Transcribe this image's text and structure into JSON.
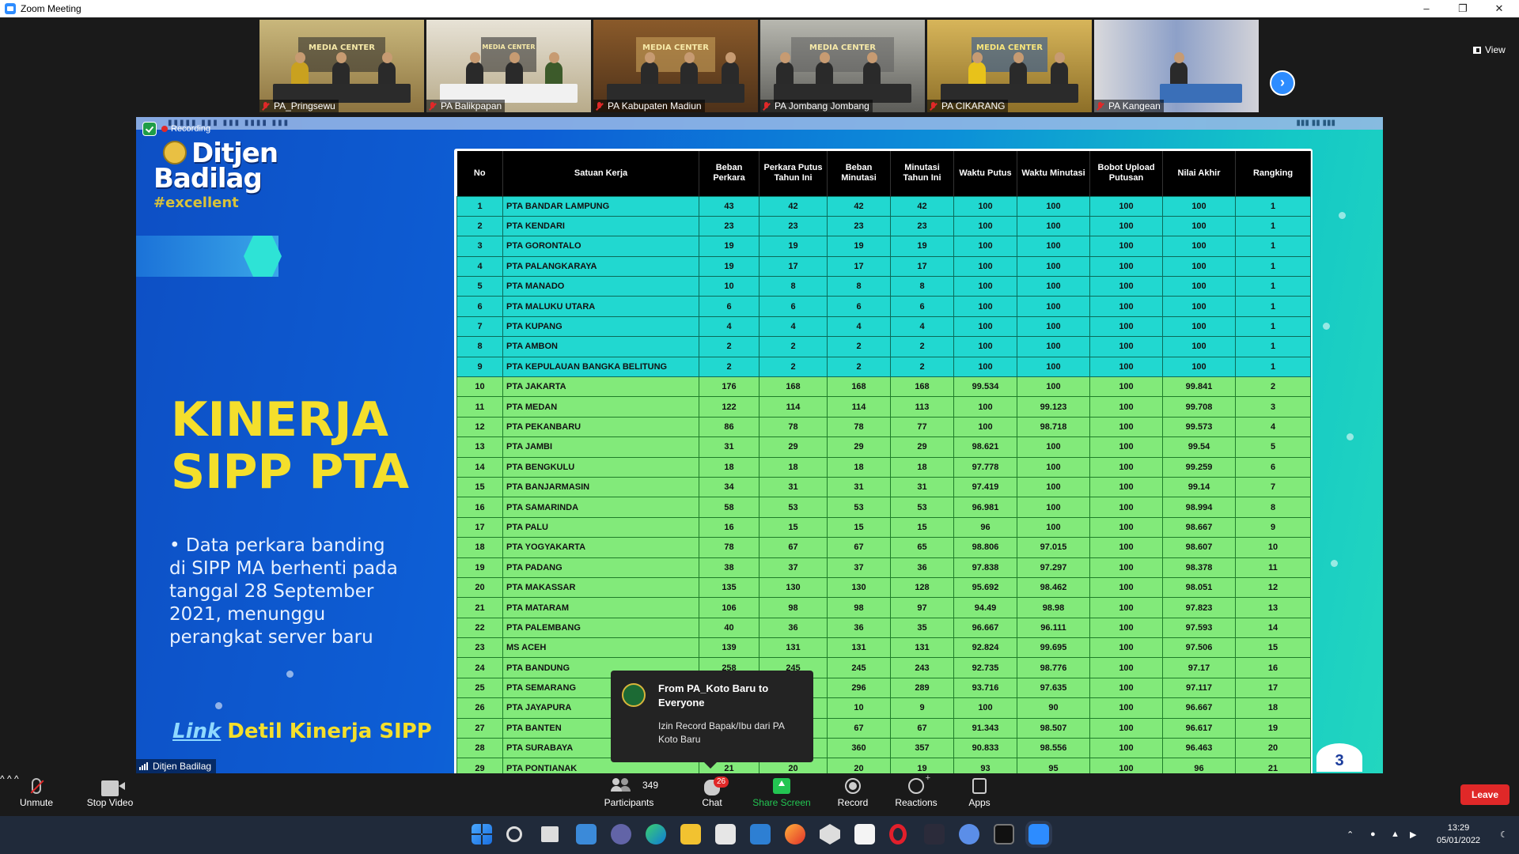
{
  "window": {
    "title": "Zoom Meeting"
  },
  "gallery": {
    "tiles": [
      {
        "name": "PA_Pringsewu",
        "banner": "MEDIA CENTER"
      },
      {
        "name": "PA Balikpapan",
        "banner": "MEDIA CENTER"
      },
      {
        "name": "PA Kabupaten Madiun",
        "banner": "MEDIA CENTER"
      },
      {
        "name": "PA Jombang Jombang",
        "banner": "MEDIA CENTER"
      },
      {
        "name": "PA CIKARANG",
        "banner": "MEDIA CENTER"
      },
      {
        "name": "PA Kangean",
        "banner": ""
      }
    ],
    "view_label": "View"
  },
  "share": {
    "recording_label": "Recording",
    "logo": {
      "line1": "Ditjen",
      "line2": "Badilag",
      "tagline": "#excellent"
    },
    "title_line1": "KINERJA",
    "title_line2": "SIPP PTA",
    "note_bullet": "•",
    "note": "Data perkara banding di SIPP MA berhenti pada tanggal 28 September 2021, menunggu perangkat server baru",
    "link_word": "Link",
    "link_text": "Detil Kinerja SIPP",
    "sharer_name": "Ditjen Badilag",
    "page_number": "3"
  },
  "table": {
    "headers": [
      "No",
      "Satuan Kerja",
      "Beban Perkara",
      "Perkara Putus Tahun Ini",
      "Beban Minutasi",
      "Minutasi Tahun Ini",
      "Waktu Putus",
      "Waktu Minutasi",
      "Bobot Upload Putusan",
      "Nilai Akhir",
      "Rangking"
    ],
    "rows": [
      {
        "c": [
          "1",
          "PTA BANDAR LAMPUNG",
          "43",
          "42",
          "42",
          "42",
          "100",
          "100",
          "100",
          "100",
          "1"
        ],
        "color": "cyan"
      },
      {
        "c": [
          "2",
          "PTA KENDARI",
          "23",
          "23",
          "23",
          "23",
          "100",
          "100",
          "100",
          "100",
          "1"
        ],
        "color": "cyan"
      },
      {
        "c": [
          "3",
          "PTA GORONTALO",
          "19",
          "19",
          "19",
          "19",
          "100",
          "100",
          "100",
          "100",
          "1"
        ],
        "color": "cyan"
      },
      {
        "c": [
          "4",
          "PTA PALANGKARAYA",
          "19",
          "17",
          "17",
          "17",
          "100",
          "100",
          "100",
          "100",
          "1"
        ],
        "color": "cyan"
      },
      {
        "c": [
          "5",
          "PTA MANADO",
          "10",
          "8",
          "8",
          "8",
          "100",
          "100",
          "100",
          "100",
          "1"
        ],
        "color": "cyan"
      },
      {
        "c": [
          "6",
          "PTA MALUKU UTARA",
          "6",
          "6",
          "6",
          "6",
          "100",
          "100",
          "100",
          "100",
          "1"
        ],
        "color": "cyan"
      },
      {
        "c": [
          "7",
          "PTA KUPANG",
          "4",
          "4",
          "4",
          "4",
          "100",
          "100",
          "100",
          "100",
          "1"
        ],
        "color": "cyan"
      },
      {
        "c": [
          "8",
          "PTA AMBON",
          "2",
          "2",
          "2",
          "2",
          "100",
          "100",
          "100",
          "100",
          "1"
        ],
        "color": "cyan"
      },
      {
        "c": [
          "9",
          "PTA KEPULAUAN BANGKA BELITUNG",
          "2",
          "2",
          "2",
          "2",
          "100",
          "100",
          "100",
          "100",
          "1"
        ],
        "color": "cyan"
      },
      {
        "c": [
          "10",
          "PTA JAKARTA",
          "176",
          "168",
          "168",
          "168",
          "99.534",
          "100",
          "100",
          "99.841",
          "2"
        ],
        "color": "green"
      },
      {
        "c": [
          "11",
          "PTA MEDAN",
          "122",
          "114",
          "114",
          "113",
          "100",
          "99.123",
          "100",
          "99.708",
          "3"
        ],
        "color": "green"
      },
      {
        "c": [
          "12",
          "PTA PEKANBARU",
          "86",
          "78",
          "78",
          "77",
          "100",
          "98.718",
          "100",
          "99.573",
          "4"
        ],
        "color": "green"
      },
      {
        "c": [
          "13",
          "PTA JAMBI",
          "31",
          "29",
          "29",
          "29",
          "98.621",
          "100",
          "100",
          "99.54",
          "5"
        ],
        "color": "green"
      },
      {
        "c": [
          "14",
          "PTA BENGKULU",
          "18",
          "18",
          "18",
          "18",
          "97.778",
          "100",
          "100",
          "99.259",
          "6"
        ],
        "color": "green"
      },
      {
        "c": [
          "15",
          "PTA BANJARMASIN",
          "34",
          "31",
          "31",
          "31",
          "97.419",
          "100",
          "100",
          "99.14",
          "7"
        ],
        "color": "green"
      },
      {
        "c": [
          "16",
          "PTA SAMARINDA",
          "58",
          "53",
          "53",
          "53",
          "96.981",
          "100",
          "100",
          "98.994",
          "8"
        ],
        "color": "green"
      },
      {
        "c": [
          "17",
          "PTA PALU",
          "16",
          "15",
          "15",
          "15",
          "96",
          "100",
          "100",
          "98.667",
          "9"
        ],
        "color": "green"
      },
      {
        "c": [
          "18",
          "PTA YOGYAKARTA",
          "78",
          "67",
          "67",
          "65",
          "98.806",
          "97.015",
          "100",
          "98.607",
          "10"
        ],
        "color": "green"
      },
      {
        "c": [
          "19",
          "PTA PADANG",
          "38",
          "37",
          "37",
          "36",
          "97.838",
          "97.297",
          "100",
          "98.378",
          "11"
        ],
        "color": "green"
      },
      {
        "c": [
          "20",
          "PTA MAKASSAR",
          "135",
          "130",
          "130",
          "128",
          "95.692",
          "98.462",
          "100",
          "98.051",
          "12"
        ],
        "color": "green"
      },
      {
        "c": [
          "21",
          "PTA MATARAM",
          "106",
          "98",
          "98",
          "97",
          "94.49",
          "98.98",
          "100",
          "97.823",
          "13"
        ],
        "color": "green"
      },
      {
        "c": [
          "22",
          "PTA PALEMBANG",
          "40",
          "36",
          "36",
          "35",
          "96.667",
          "96.111",
          "100",
          "97.593",
          "14"
        ],
        "color": "green"
      },
      {
        "c": [
          "23",
          "MS ACEH",
          "139",
          "131",
          "131",
          "131",
          "92.824",
          "99.695",
          "100",
          "97.506",
          "15"
        ],
        "color": "green"
      },
      {
        "c": [
          "24",
          "PTA BANDUNG",
          "258",
          "245",
          "245",
          "243",
          "92.735",
          "98.776",
          "100",
          "97.17",
          "16"
        ],
        "color": "green"
      },
      {
        "c": [
          "25",
          "PTA SEMARANG",
          "",
          "",
          "296",
          "289",
          "93.716",
          "97.635",
          "100",
          "97.117",
          "17"
        ],
        "color": "green"
      },
      {
        "c": [
          "26",
          "PTA JAYAPURA",
          "",
          "",
          "10",
          "9",
          "100",
          "90",
          "100",
          "96.667",
          "18"
        ],
        "color": "green"
      },
      {
        "c": [
          "27",
          "PTA BANTEN",
          "",
          "",
          "67",
          "67",
          "91.343",
          "98.507",
          "100",
          "96.617",
          "19"
        ],
        "color": "green"
      },
      {
        "c": [
          "28",
          "PTA SURABAYA",
          "",
          "",
          "360",
          "357",
          "90.833",
          "98.556",
          "100",
          "96.463",
          "20"
        ],
        "color": "green"
      },
      {
        "c": [
          "29",
          "PTA PONTIANAK",
          "21",
          "20",
          "20",
          "19",
          "93",
          "95",
          "100",
          "96",
          "21"
        ],
        "color": "green"
      }
    ]
  },
  "chat_toast": {
    "from": "From PA_Koto Baru to Everyone",
    "message": "Izin Record Bapak/Ibu dari PA Koto Baru"
  },
  "toolbar": {
    "unmute": "Unmute",
    "stop_video": "Stop Video",
    "participants": "Participants",
    "participant_count": "349",
    "chat": "Chat",
    "chat_badge": "26",
    "share_screen": "Share Screen",
    "record": "Record",
    "reactions": "Reactions",
    "apps": "Apps",
    "leave": "Leave"
  },
  "taskbar": {
    "time": "13:29",
    "date": "05/01/2022"
  },
  "colors": {
    "zoom_blue": "#2d8cff",
    "leave_red": "#e02828",
    "row_cyan": "#21d8d0",
    "row_green": "#82ea7a",
    "title_yellow": "#f4df2c"
  }
}
